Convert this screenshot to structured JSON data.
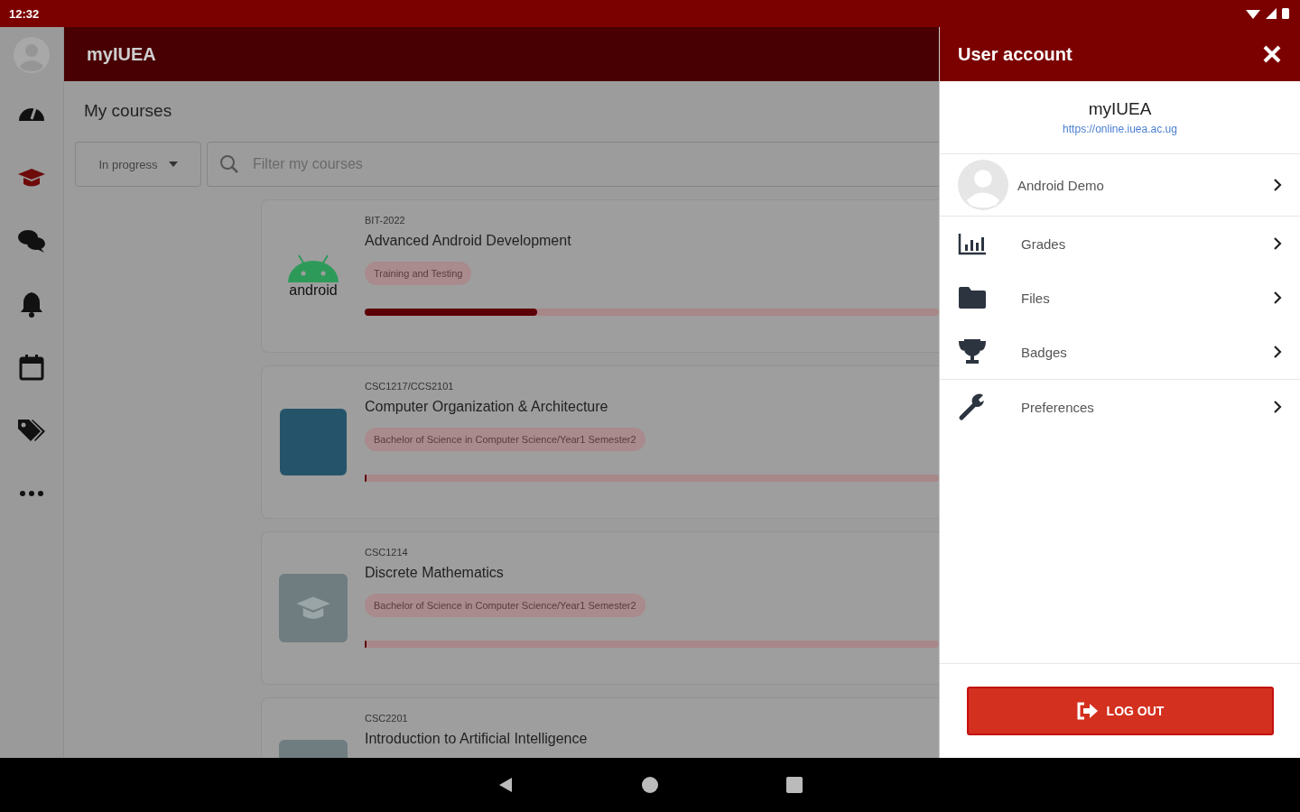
{
  "status_bar": {
    "time": "12:32"
  },
  "app_bar": {
    "title": "myIUEA"
  },
  "rail": [
    {
      "kind": "dashboard",
      "selected": false
    },
    {
      "kind": "courses",
      "selected": true
    },
    {
      "kind": "messages",
      "selected": false
    },
    {
      "kind": "notifications",
      "selected": false
    },
    {
      "kind": "calendar",
      "selected": false
    },
    {
      "kind": "tags",
      "selected": false
    },
    {
      "kind": "more",
      "selected": false
    }
  ],
  "page_title": "My courses",
  "filter": {
    "value": "In progress"
  },
  "search": {
    "placeholder": "Filter my courses"
  },
  "courses": [
    {
      "code": "BIT-2022",
      "name": "Advanced Android Development",
      "tag": "Training and Testing",
      "kind": "android",
      "logo_text": "android",
      "level": 0.3
    },
    {
      "code": "CSC1217/CCS2101",
      "name": "Computer Organization & Architecture",
      "tag": "Bachelor of Science in Computer Science/Year1 Semester2",
      "kind": "photo",
      "level": 0
    },
    {
      "code": "CSC1214",
      "name": "Discrete Mathematics",
      "tag": "Bachelor of Science in Computer Science/Year1 Semester2",
      "kind": "placeholder",
      "level": 0
    },
    {
      "code": "CSC2201",
      "name": "Introduction to Artificial Intelligence",
      "kind": "placeholder"
    }
  ],
  "drawer": {
    "title": "User account",
    "site_name": "myIUEA",
    "site_url": "https://online.iuea.ac.ug",
    "user_name": "Android Demo",
    "items": [
      {
        "kind": "grades",
        "label": "Grades",
        "divider_before": false
      },
      {
        "kind": "files",
        "label": "Files",
        "divider_before": false
      },
      {
        "kind": "badges",
        "label": "Badges",
        "divider_before": false
      },
      {
        "kind": "preferences",
        "label": "Preferences",
        "divider_before": true
      }
    ],
    "logout": "LOG OUT"
  }
}
